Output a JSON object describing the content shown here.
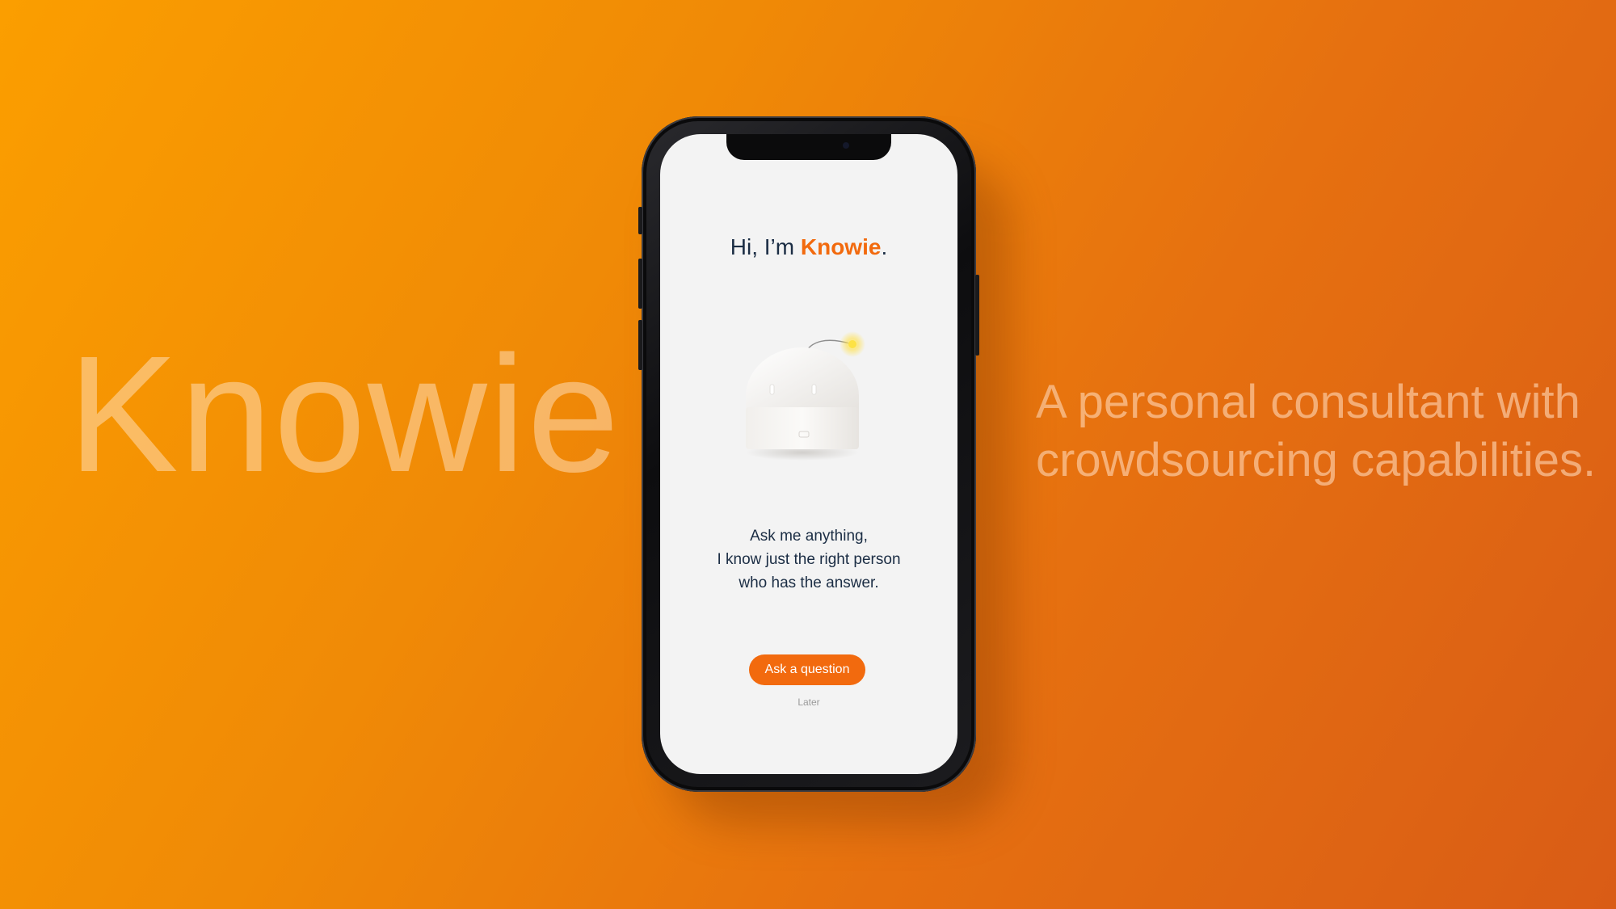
{
  "slide": {
    "brand_word": "Knowie",
    "tagline_lines": [
      "A personal consultant with",
      "crowdsourcing capabilities."
    ]
  },
  "app": {
    "greeting_prefix": "Hi, I’m ",
    "greeting_brand": "Knowie",
    "greeting_suffix": ".",
    "message_lines": [
      "Ask me anything,",
      "I know just the right person",
      "who has the answer."
    ],
    "primary_button_label": "Ask a question",
    "secondary_link_label": "Later",
    "robot_icon": "robot-mascot-icon"
  },
  "colors": {
    "accent": "#f26a0e",
    "text_dark": "#1b2d44",
    "screen_bg": "#f3f3f3",
    "background_start": "#fb9e00",
    "background_end": "#d95c16"
  }
}
